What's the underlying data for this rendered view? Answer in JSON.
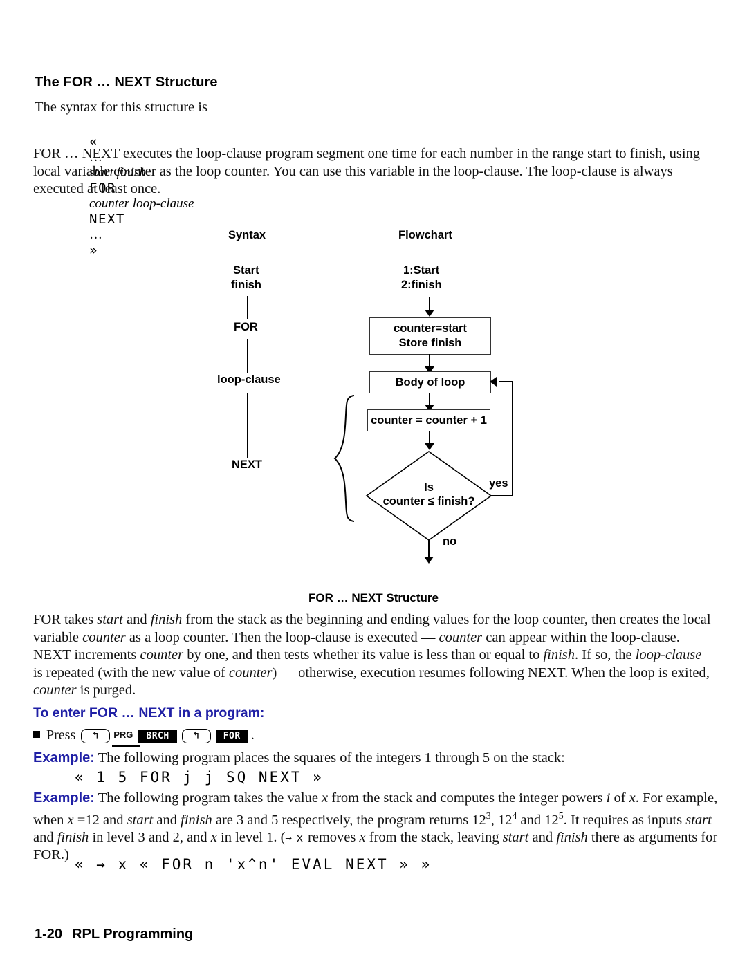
{
  "page": {
    "section_heading": "The FOR … NEXT Structure",
    "intro_line": "The syntax for this structure is",
    "syntax": {
      "guillemet_open": "«",
      "ellipsis_1": "…",
      "args": "start finish",
      "kw_for": "FOR",
      "params": "counter loop-clause",
      "kw_next": "NEXT",
      "ellipsis_2": "…",
      "guillemet_close": "»"
    },
    "paragraph_1": "FOR … NEXT executes the loop-clause program segment one time for each number in the range start to finish, using local variable counter as the loop counter. You can use this variable in the loop-clause. The loop-clause is always executed at least  once.",
    "paragraph_2_parts": {
      "a": "FOR takes ",
      "b": "start",
      "c": " and ",
      "d": "finish",
      "e": " from the stack as the beginning and ending values for the loop counter, then creates the local variable ",
      "f": "counter",
      "g": " as a loop counter. Then the loop-clause is executed — ",
      "h": "counter",
      "i": " can appear within the loop-clause. NEXT increments ",
      "j": "counter",
      "k": " by one, and then tests whether its value is less than or equal to ",
      "l": "finish",
      "m": ". If so, the ",
      "n": "loop-clause",
      "o": " is repeated (with the new value of ",
      "p": "counter",
      "q": ") — otherwise, execution resumes following NEXT. When the loop is exited, ",
      "r": "counter",
      "s": " is purged."
    },
    "enter_heading": "To enter FOR … NEXT in a program:",
    "press": {
      "label": "Press",
      "shift_arrow": "↰",
      "key_prg": "PRG",
      "menu_brch": "BRCH",
      "menu_for": "FOR",
      "period": "."
    },
    "example_1": {
      "label": "Example:",
      "text": " The following program places the squares of the integers 1 through 5 on the stack:",
      "code": "« 1 5 FOR j j SQ NEXT »"
    },
    "example_2": {
      "label": "Example:",
      "t1": " The following program takes the value ",
      "x1": "x",
      "t2": " from the stack and computes the integer powers ",
      "i1": "i",
      "t3": " of ",
      "x2": "x",
      "t4": ". For example, when ",
      "x3": "x",
      "t5": " =12 and ",
      "s1": "start",
      "t6": " and ",
      "f1": "finish",
      "t7": " are 3 and 5 respectively, the program returns 12",
      "p1": "3",
      "t8": ", 12",
      "p2": "4",
      "t9": " and 12",
      "p3": "5",
      "t10": ". It requires as inputs ",
      "s2": "start",
      "t11": " and ",
      "f2": "finish",
      "t12": " in level 3 and 2, and ",
      "x4": "x",
      "t13": " in level 1. (",
      "glyph_arrow": "→",
      "glyph_x": "x",
      "t14": " removes ",
      "x5": "x",
      "t15": " from the stack, leaving ",
      "s3": "start",
      "t16": " and ",
      "f3": "finish",
      "t17": " there as arguments for FOR.)",
      "code": "« → x « FOR n 'x^n' EVAL NEXT » »"
    },
    "footer": {
      "page_number": "1-20",
      "title": "RPL Programming"
    }
  },
  "figure": {
    "caption": "FOR … NEXT Structure",
    "col_syntax_header": "Syntax",
    "col_flow_header": "Flowchart",
    "syntax_steps": {
      "start": "Start",
      "finish": "finish",
      "for": "FOR",
      "loop_clause": "loop-clause",
      "next": "NEXT"
    },
    "stack": {
      "line1": "1:Start",
      "line2": "2:finish"
    },
    "box_init": {
      "l1": "counter=start",
      "l2": "Store finish"
    },
    "box_body": "Body of loop",
    "box_incr": "counter = counter + 1",
    "decision": {
      "l1": "Is",
      "l2": "counter ≤ finish?"
    },
    "label_yes": "yes",
    "label_no": "no"
  }
}
